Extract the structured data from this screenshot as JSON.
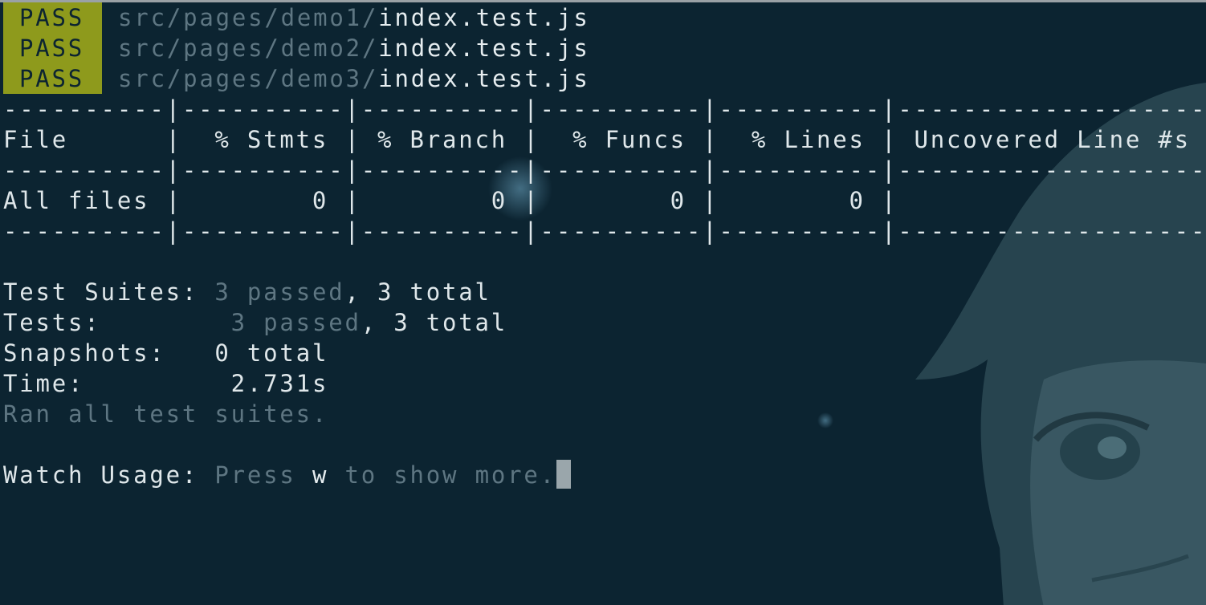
{
  "test_results": [
    {
      "status": "PASS",
      "dir": "src/pages/demo1/",
      "file": "index.test.js"
    },
    {
      "status": "PASS",
      "dir": "src/pages/demo2/",
      "file": "index.test.js"
    },
    {
      "status": "PASS",
      "dir": "src/pages/demo3/",
      "file": "index.test.js"
    }
  ],
  "coverage_table": {
    "separator": "----------|----------|----------|----------|----------|-------------------|",
    "header": "File      |  % Stmts | % Branch |  % Funcs |  % Lines | Uncovered Line #s |",
    "rows": [
      "All files |        0 |        0 |        0 |        0 |                   |"
    ]
  },
  "summary": {
    "test_suites_label": "Test Suites:",
    "test_suites_value": "3 passed, 3 total",
    "tests_label": "Tests:",
    "tests_value": "3 passed, 3 total",
    "snapshots_label": "Snapshots:",
    "snapshots_value": "0 total",
    "time_label": "Time:",
    "time_value": "2.731s",
    "ran_message": "Ran all test suites."
  },
  "watch": {
    "label": "Watch Usage:",
    "press": "Press",
    "key": "w",
    "suffix": "to show more."
  }
}
